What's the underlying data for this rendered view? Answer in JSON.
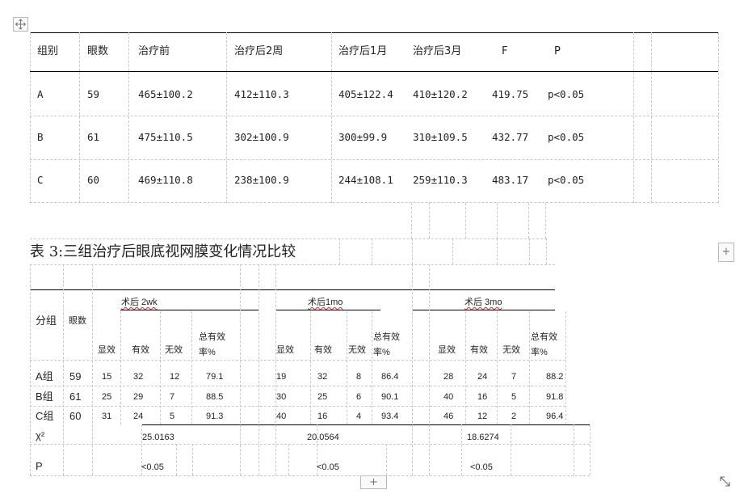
{
  "table2": {
    "headers": [
      "组别",
      "眼数",
      "治疗前",
      "治疗后2周",
      "治疗后1月",
      "治疗后3月",
      "F",
      "P"
    ],
    "rows": [
      [
        "A",
        "59",
        "465±100.2",
        "412±110.3",
        "405±122.4",
        "410±120.2",
        "419.75",
        "p<0.05"
      ],
      [
        "B",
        "61",
        "475±110.5",
        "302±100.9",
        "300±99.9",
        "310±109.5",
        "432.77",
        "p<0.05"
      ],
      [
        "C",
        "60",
        "469±110.8",
        "238±100.9",
        "244±108.1",
        "259±110.3",
        "483.17",
        "p<0.05"
      ]
    ]
  },
  "table3": {
    "caption": "表 3:三组治疗后眼底视网膜变化情况比较",
    "group_header": "分组",
    "eyes_header": "眼数",
    "periods": [
      "术后 2wk",
      "术后1mo",
      "术后 3mo"
    ],
    "sub_headers": [
      "显效",
      "有效",
      "无效",
      "总有效率%"
    ],
    "rows": [
      {
        "group": "A组",
        "eyes": "59",
        "values": [
          [
            "15",
            "32",
            "12",
            "79.1"
          ],
          [
            "19",
            "32",
            "8",
            "86.4"
          ],
          [
            "28",
            "24",
            "7",
            "88.2"
          ]
        ]
      },
      {
        "group": "B组",
        "eyes": "61",
        "values": [
          [
            "25",
            "29",
            "7",
            "88.5"
          ],
          [
            "30",
            "25",
            "6",
            "90.1"
          ],
          [
            "40",
            "16",
            "5",
            "91.8"
          ]
        ]
      },
      {
        "group": "C组",
        "eyes": "60",
        "values": [
          [
            "31",
            "24",
            "5",
            "91.3"
          ],
          [
            "40",
            "16",
            "4",
            "93.4"
          ],
          [
            "46",
            "12",
            "2",
            "96.4"
          ]
        ]
      }
    ],
    "chi_label": "χ²",
    "chi_values": [
      "25.0163",
      "20.0564",
      "18.6274"
    ],
    "p_label": "P",
    "p_values": [
      "<0.05",
      "<0.05",
      "<0.05"
    ]
  },
  "icons": {
    "move_handle": "move-icon",
    "add_column": "plus-icon",
    "add_row": "plus-icon",
    "resize_handle": "resize-icon"
  },
  "handles": {
    "add_column": "+",
    "add_row": "+"
  }
}
